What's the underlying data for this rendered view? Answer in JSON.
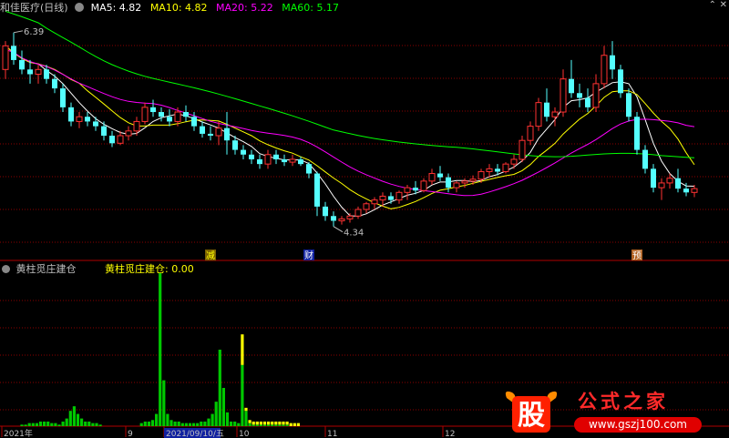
{
  "header": {
    "stock_title": "和佳医疗(日线)",
    "ma_items": [
      {
        "label": "MA5: 4.82",
        "color": "#ffffff"
      },
      {
        "label": "MA10: 4.82",
        "color": "#ffff00"
      },
      {
        "label": "MA20: 5.22",
        "color": "#ff00ff"
      },
      {
        "label": "MA60: 5.17",
        "color": "#00ff00"
      }
    ]
  },
  "indicator": {
    "name": "黄柱觅庄建仓",
    "value_label": "黄柱觅庄建仓: 0.00"
  },
  "markers": [
    {
      "text": "减",
      "color": "#ffff00",
      "bg": "#7a6000"
    },
    {
      "text": "财",
      "color": "#ffffff",
      "bg": "#1020a0"
    },
    {
      "text": "预",
      "color": "#ffffff",
      "bg": "#b06020"
    }
  ],
  "time_axis": {
    "labels": [
      "2021年",
      "9",
      "2021/09/10/五",
      "10",
      "11",
      "12"
    ],
    "highlight_label": "2021/09/10/五"
  },
  "watermark": {
    "logo_char": "股",
    "site_name": "公式之家",
    "url": "www.gszj100.com"
  },
  "colors": {
    "up": "#ff3232",
    "down": "#54ffff",
    "ma5": "#ffffff",
    "ma10": "#ffff00",
    "ma20": "#ff00ff",
    "ma60": "#00ff00",
    "bar_green": "#00c800",
    "bar_yellow": "#ffff00",
    "grid": "#8b0000"
  },
  "chart_data": [
    {
      "type": "candlestick",
      "title": "和佳医疗(日线)",
      "ylim": [
        4.0,
        6.6
      ],
      "annotations": [
        {
          "text": "6.39",
          "type": "high"
        },
        {
          "text": "4.34",
          "type": "low"
        }
      ],
      "series": [
        {
          "name": "MA5",
          "last": 4.82
        },
        {
          "name": "MA10",
          "last": 4.82
        },
        {
          "name": "MA20",
          "last": 5.22
        },
        {
          "name": "MA60",
          "last": 5.17
        }
      ],
      "ohlc": [
        [
          6.0,
          6.3,
          5.9,
          6.25
        ],
        [
          6.25,
          6.39,
          6.05,
          6.1
        ],
        [
          6.1,
          6.2,
          5.95,
          6.0
        ],
        [
          6.0,
          6.1,
          5.85,
          5.95
        ],
        [
          5.95,
          6.05,
          5.85,
          6.0
        ],
        [
          6.0,
          6.05,
          5.85,
          5.9
        ],
        [
          5.9,
          5.95,
          5.75,
          5.8
        ],
        [
          5.8,
          5.85,
          5.55,
          5.6
        ],
        [
          5.6,
          5.65,
          5.4,
          5.45
        ],
        [
          5.45,
          5.55,
          5.38,
          5.5
        ],
        [
          5.5,
          5.55,
          5.4,
          5.45
        ],
        [
          5.45,
          5.5,
          5.35,
          5.4
        ],
        [
          5.4,
          5.45,
          5.25,
          5.3
        ],
        [
          5.3,
          5.35,
          5.18,
          5.22
        ],
        [
          5.22,
          5.35,
          5.2,
          5.3
        ],
        [
          5.3,
          5.4,
          5.25,
          5.35
        ],
        [
          5.35,
          5.5,
          5.3,
          5.45
        ],
        [
          5.45,
          5.65,
          5.42,
          5.6
        ],
        [
          5.6,
          5.68,
          5.5,
          5.55
        ],
        [
          5.55,
          5.6,
          5.45,
          5.5
        ],
        [
          5.5,
          5.58,
          5.4,
          5.45
        ],
        [
          5.45,
          5.6,
          5.4,
          5.55
        ],
        [
          5.55,
          5.62,
          5.45,
          5.5
        ],
        [
          5.5,
          5.55,
          5.35,
          5.4
        ],
        [
          5.4,
          5.45,
          5.28,
          5.32
        ],
        [
          5.32,
          5.4,
          5.25,
          5.3
        ],
        [
          5.3,
          5.45,
          5.2,
          5.38
        ],
        [
          5.38,
          5.55,
          5.1,
          5.25
        ],
        [
          5.25,
          5.3,
          5.1,
          5.15
        ],
        [
          5.15,
          5.2,
          5.05,
          5.1
        ],
        [
          5.1,
          5.15,
          5.0,
          5.05
        ],
        [
          5.05,
          5.1,
          4.95,
          5.0
        ],
        [
          5.0,
          5.15,
          4.95,
          5.1
        ],
        [
          5.1,
          5.15,
          5.0,
          5.05
        ],
        [
          5.05,
          5.1,
          4.98,
          5.02
        ],
        [
          5.02,
          5.1,
          4.98,
          5.05
        ],
        [
          5.05,
          5.08,
          4.98,
          5.0
        ],
        [
          5.0,
          5.02,
          4.85,
          4.9
        ],
        [
          4.9,
          4.92,
          4.45,
          4.55
        ],
        [
          4.55,
          4.6,
          4.4,
          4.45
        ],
        [
          4.45,
          4.5,
          4.34,
          4.4
        ],
        [
          4.4,
          4.45,
          4.36,
          4.42
        ],
        [
          4.42,
          4.48,
          4.38,
          4.45
        ],
        [
          4.45,
          4.55,
          4.42,
          4.52
        ],
        [
          4.52,
          4.6,
          4.48,
          4.58
        ],
        [
          4.58,
          4.65,
          4.52,
          4.62
        ],
        [
          4.62,
          4.7,
          4.55,
          4.66
        ],
        [
          4.66,
          4.7,
          4.58,
          4.62
        ],
        [
          4.62,
          4.72,
          4.58,
          4.7
        ],
        [
          4.7,
          4.78,
          4.62,
          4.75
        ],
        [
          4.75,
          4.82,
          4.68,
          4.72
        ],
        [
          4.72,
          4.85,
          4.7,
          4.82
        ],
        [
          4.82,
          4.95,
          4.78,
          4.9
        ],
        [
          4.9,
          4.98,
          4.82,
          4.86
        ],
        [
          4.86,
          4.9,
          4.7,
          4.75
        ],
        [
          4.75,
          4.82,
          4.7,
          4.8
        ],
        [
          4.8,
          4.85,
          4.75,
          4.82
        ],
        [
          4.82,
          4.88,
          4.78,
          4.84
        ],
        [
          4.84,
          4.95,
          4.8,
          4.92
        ],
        [
          4.92,
          5.0,
          4.86,
          4.95
        ],
        [
          4.95,
          5.0,
          4.88,
          4.92
        ],
        [
          4.92,
          5.02,
          4.9,
          5.0
        ],
        [
          5.0,
          5.1,
          4.95,
          5.05
        ],
        [
          5.05,
          5.3,
          5.02,
          5.25
        ],
        [
          5.25,
          5.45,
          5.2,
          5.4
        ],
        [
          5.4,
          5.7,
          5.35,
          5.65
        ],
        [
          5.65,
          5.8,
          5.45,
          5.5
        ],
        [
          5.5,
          5.6,
          5.4,
          5.55
        ],
        [
          5.55,
          6.0,
          5.5,
          5.9
        ],
        [
          5.9,
          6.1,
          5.7,
          5.75
        ],
        [
          5.75,
          5.85,
          5.6,
          5.7
        ],
        [
          5.7,
          5.8,
          5.55,
          5.6
        ],
        [
          5.6,
          5.95,
          5.55,
          5.85
        ],
        [
          5.85,
          6.25,
          5.8,
          6.15
        ],
        [
          6.15,
          6.3,
          5.9,
          6.0
        ],
        [
          6.0,
          6.05,
          5.7,
          5.75
        ],
        [
          5.75,
          5.8,
          5.45,
          5.5
        ],
        [
          5.5,
          5.55,
          5.1,
          5.15
        ],
        [
          5.15,
          5.2,
          4.9,
          4.95
        ],
        [
          4.95,
          5.0,
          4.7,
          4.75
        ],
        [
          4.75,
          4.85,
          4.62,
          4.8
        ],
        [
          4.8,
          4.9,
          4.74,
          4.85
        ],
        [
          4.85,
          4.95,
          4.7,
          4.74
        ],
        [
          4.74,
          4.8,
          4.66,
          4.7
        ],
        [
          4.7,
          4.78,
          4.65,
          4.74
        ]
      ]
    },
    {
      "type": "bar",
      "title": "黄柱觅庄建仓",
      "ylim": [
        0,
        100
      ],
      "last_value": 0.0,
      "series": [
        {
          "name": "green",
          "values": [
            0,
            0,
            0,
            0,
            1,
            1,
            2,
            2,
            2,
            3,
            3,
            3,
            2,
            2,
            1,
            3,
            5,
            10,
            13,
            8,
            5,
            3,
            3,
            2,
            2,
            1,
            0,
            0,
            0,
            0,
            0,
            0,
            0,
            0,
            0,
            0,
            2,
            3,
            3,
            4,
            8,
            100,
            30,
            8,
            4,
            3,
            3,
            2,
            2,
            2,
            2,
            2,
            3,
            3,
            5,
            8,
            16,
            50,
            25,
            9,
            3,
            3,
            2,
            40,
            10,
            2,
            1,
            1,
            1,
            1,
            1,
            1,
            1,
            1,
            1,
            1,
            0,
            0,
            0,
            0,
            0,
            0,
            0,
            0,
            0,
            0,
            0,
            0,
            0,
            0,
            0,
            0,
            0,
            0,
            0,
            0,
            0,
            0,
            0,
            0,
            0
          ]
        },
        {
          "name": "yellow",
          "values": [
            0,
            0,
            0,
            0,
            0,
            0,
            0,
            0,
            0,
            0,
            0,
            0,
            0,
            0,
            0,
            0,
            0,
            0,
            0,
            0,
            0,
            0,
            0,
            0,
            0,
            0,
            0,
            0,
            0,
            0,
            0,
            0,
            0,
            0,
            0,
            0,
            0,
            0,
            0,
            0,
            0,
            0,
            0,
            0,
            0,
            0,
            0,
            0,
            0,
            0,
            0,
            0,
            0,
            0,
            0,
            0,
            0,
            0,
            0,
            0,
            0,
            0,
            0,
            20,
            2,
            2,
            2,
            2,
            2,
            2,
            2,
            2,
            2,
            2,
            2,
            2,
            2,
            2,
            2,
            0,
            0,
            0,
            0,
            0,
            0,
            0,
            0,
            0,
            0,
            0,
            0,
            0,
            0,
            0,
            0,
            0,
            0,
            0,
            0,
            0,
            0
          ]
        }
      ]
    }
  ]
}
